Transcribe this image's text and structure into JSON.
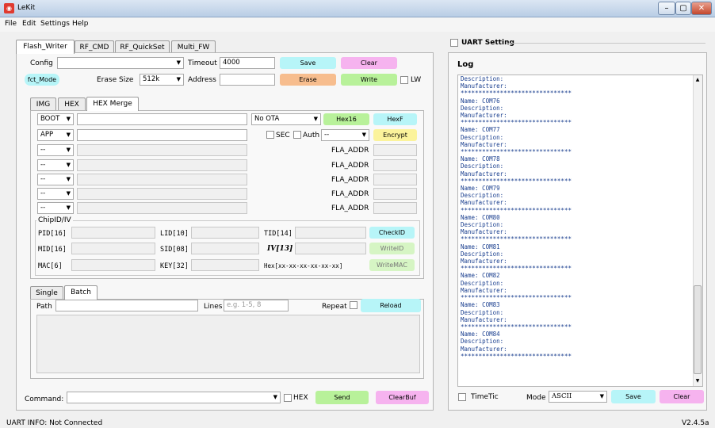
{
  "window": {
    "title": "LeKit",
    "icon": "app-icon",
    "minimize": "–",
    "maximize": "▢",
    "close": "✕"
  },
  "menu": [
    "File",
    "Edit",
    "Settings",
    "Help"
  ],
  "main_tabs": [
    "Flash_Writer",
    "RF_CMD",
    "RF_QuickSet",
    "Multi_FW"
  ],
  "flash": {
    "config_label": "Config",
    "config_value": "",
    "timeout_label": "Timeout",
    "timeout_value": "4000",
    "save": "Save",
    "clear": "Clear",
    "fct_mode": "fct_Mode",
    "erase_size_label": "Erase Size",
    "erase_size_value": "512k",
    "address_label": "Address",
    "address_value": "",
    "erase": "Erase",
    "write": "Write",
    "lw": "LW"
  },
  "sub_tabs": [
    "IMG",
    "HEX",
    "HEX Merge"
  ],
  "hex_merge": {
    "boot_label": "BOOT",
    "ota_value": "No OTA",
    "hex16": "Hex16",
    "hexf": "HexF",
    "app_label": "APP",
    "sec": "SEC",
    "auth": "Auth",
    "auth_value": "--",
    "encrypt": "Encrypt",
    "extra_combo": "--",
    "fla_addr": "FLA_ADDR"
  },
  "chipid": {
    "group_title": "ChipID/IV",
    "pid": "PID[16]",
    "lid": "LID[10]",
    "tid": "TID[14]",
    "checkid": "CheckID",
    "mid": "MID[16]",
    "sid": "SID[08]",
    "iv": "IV[13]",
    "writeid": "WriteID",
    "mac": "MAC[6]",
    "key": "KEY[32]",
    "hex_format": "Hex[xx-xx-xx-xx-xx-xx]",
    "writemac": "WriteMAC"
  },
  "batch_tabs": [
    "Single",
    "Batch"
  ],
  "batch": {
    "path_label": "Path",
    "lines_label": "Lines",
    "lines_placeholder": "e.g. 1-5, 8",
    "repeat_label": "Repeat",
    "reload": "Reload"
  },
  "command": {
    "label": "Command:",
    "hex_label": "HEX",
    "send": "Send",
    "clearbuf": "ClearBuf"
  },
  "uart": {
    "setting_label": "UART Setting",
    "log_title": "Log",
    "log_text": "Description:\nManufacturer:\n*******************************\nName: COM76\nDescription:\nManufacturer:\n*******************************\nName: COM77\nDescription:\nManufacturer:\n*******************************\nName: COM78\nDescription:\nManufacturer:\n*******************************\nName: COM79\nDescription:\nManufacturer:\n*******************************\nName: COM80\nDescription:\nManufacturer:\n*******************************\nName: COM81\nDescription:\nManufacturer:\n*******************************\nName: COM82\nDescription:\nManufacturer:\n*******************************\nName: COM83\nDescription:\nManufacturer:\n*******************************\nName: COM84\nDescription:\nManufacturer:\n*******************************",
    "timetic": "TimeTic",
    "mode_label": "Mode",
    "mode_value": "ASCII",
    "save": "Save",
    "clear": "Clear"
  },
  "status": {
    "info": "UART INFO: Not Connected",
    "version": "V2.4.5a"
  },
  "colors": {
    "save": "#b7f5f8",
    "clear": "#f6b3ef",
    "erase": "#f7bd8e",
    "write": "#b8f19a",
    "fct": "#b7f5f8",
    "hex16": "#b8f19a",
    "hexf": "#b7f5f8",
    "encrypt": "#fbf39b",
    "checkid": "#b7f5f8",
    "writeid_disabled": "#d6f5c4",
    "reload": "#b7f5f8",
    "send": "#b8f19a",
    "clearbuf": "#f6b3ef"
  }
}
